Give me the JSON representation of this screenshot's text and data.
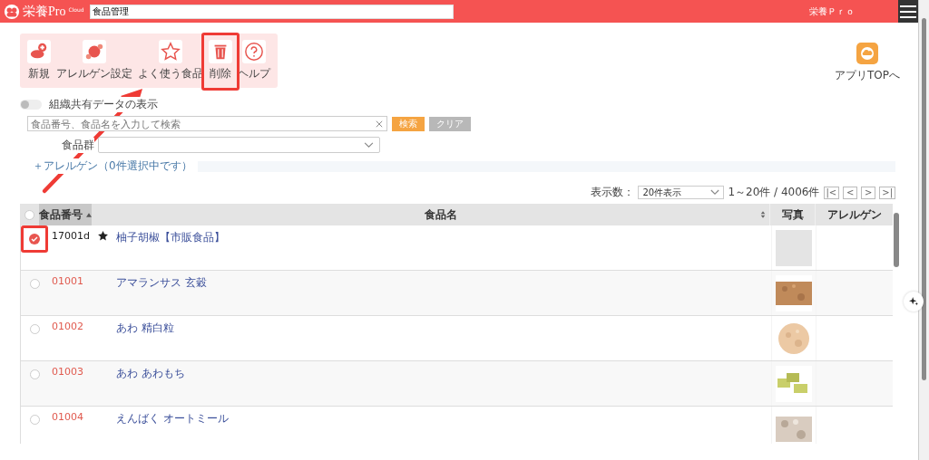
{
  "header": {
    "logo_text": "栄養Pro",
    "logo_sup": "Cloud",
    "search_value": "食品管理",
    "user": "栄養Ｐｒｏ"
  },
  "tools": [
    {
      "label": "新規",
      "highlighted": false
    },
    {
      "label": "アレルゲン設定",
      "highlighted": false
    },
    {
      "label": "よく使う食品",
      "highlighted": false
    },
    {
      "label": "削除",
      "highlighted": true
    },
    {
      "label": "ヘルプ",
      "highlighted": false
    }
  ],
  "app_top": {
    "label": "アプリTOPへ"
  },
  "shared_toggle": {
    "label": "組織共有データの表示",
    "on": false
  },
  "search": {
    "placeholder": "食品番号、食品名を入力して検索",
    "search_button": "検索",
    "clear_button": "クリア"
  },
  "group_filter": {
    "label": "食品群"
  },
  "allergen_link": "＋アレルゲン（0件選択中です）",
  "pager": {
    "label": "表示数：",
    "per_page": "20件表示",
    "range": "1～20件 / 4006件",
    "buttons": [
      "|<",
      "<",
      ">",
      ">|"
    ]
  },
  "table": {
    "select_all_checked": false,
    "columns": [
      {
        "label": "食品番号"
      },
      {
        "label": "食品名"
      },
      {
        "label": "写真"
      },
      {
        "label": "アレルゲン"
      }
    ],
    "rows": [
      {
        "code": "17001d",
        "kind": "custom",
        "favorite": true,
        "name": "柚子胡椒【市販食品】",
        "checked": true,
        "highlighted": true
      },
      {
        "code": "01001",
        "kind": "standard",
        "favorite": false,
        "name": "アマランサス 玄穀",
        "checked": false,
        "highlighted": false
      },
      {
        "code": "01002",
        "kind": "standard",
        "favorite": false,
        "name": "あわ 精白粒",
        "checked": false,
        "highlighted": false
      },
      {
        "code": "01003",
        "kind": "standard",
        "favorite": false,
        "name": "あわ あわもち",
        "checked": false,
        "highlighted": false
      },
      {
        "code": "01004",
        "kind": "standard",
        "favorite": false,
        "name": "えんばく オートミール",
        "checked": false,
        "highlighted": false
      }
    ]
  },
  "annotation_arrow": true
}
